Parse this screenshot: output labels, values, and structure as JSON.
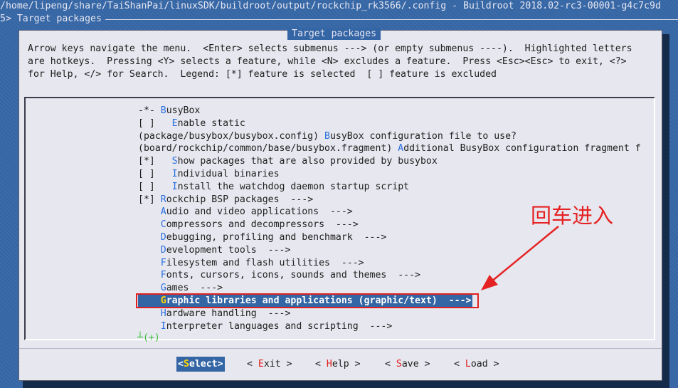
{
  "window": {
    "title": "/home/lipeng/share/TaiShanPai/linuxSDK/buildroot/output/rockchip_rk3566/.config - Buildroot 2018.02-rc3-00001-g4c7c9d",
    "breadcrumb": "5> Target packages"
  },
  "dialog": {
    "title": "Target packages",
    "help_lines": [
      "Arrow keys navigate the menu.  <Enter> selects submenus ---> (or empty submenus ----).  Highlighted letters",
      "are hotkeys.  Pressing <Y> selects a feature, while <N> excludes a feature.  Press <Esc><Esc> to exit, <?>",
      "for Help, </> for Search.  Legend: [*] feature is selected  [ ] feature is excluded"
    ]
  },
  "menu": {
    "items": [
      {
        "pre": "-*- ",
        "hot": "B",
        "rest": "usyBox"
      },
      {
        "pre": "[ ]   ",
        "hot": "E",
        "rest": "nable static"
      },
      {
        "pre": "(package/busybox/busybox.config) ",
        "hot": "B",
        "rest": "usyBox configuration file to use?"
      },
      {
        "pre": "(board/rockchip/common/base/busybox.fragment) ",
        "hot": "A",
        "rest": "dditional BusyBox configuration fragment f"
      },
      {
        "pre": "[*]   ",
        "hot": "S",
        "rest": "how packages that are also provided by busybox"
      },
      {
        "pre": "[ ]   ",
        "hot": "I",
        "rest": "ndividual binaries"
      },
      {
        "pre": "[ ]   ",
        "hot": "I",
        "rest": "nstall the watchdog daemon startup script"
      },
      {
        "pre": "[*] ",
        "hot": "R",
        "rest": "ockchip BSP packages  --->"
      },
      {
        "pre": "    ",
        "hot": "A",
        "rest": "udio and video applications  --->"
      },
      {
        "pre": "    ",
        "hot": "C",
        "rest": "ompressors and decompressors  --->"
      },
      {
        "pre": "    ",
        "hot": "D",
        "rest": "ebugging, profiling and benchmark  --->"
      },
      {
        "pre": "    ",
        "hot": "D",
        "rest": "evelopment tools  --->"
      },
      {
        "pre": "    ",
        "hot": "F",
        "rest": "ilesystem and flash utilities  --->"
      },
      {
        "pre": "    ",
        "hot": "F",
        "rest": "onts, cursors, icons, sounds and themes  --->"
      },
      {
        "pre": "    ",
        "hot": "G",
        "rest": "ames  --->"
      },
      {
        "pre": "    ",
        "hot": "G",
        "rest": "raphic libraries and applications (graphic/text)  --->"
      },
      {
        "pre": "    ",
        "hot": "H",
        "rest": "ardware handling  --->"
      },
      {
        "pre": "    ",
        "hot": "I",
        "rest": "nterpreter languages and scripting  --->"
      }
    ],
    "more_indicator": "┴(+)"
  },
  "buttons": {
    "select": {
      "pre": "<",
      "hot": "S",
      "rest": "elect>"
    },
    "exit": {
      "pre": "< ",
      "hot": "E",
      "rest": "xit >"
    },
    "help": {
      "pre": "< ",
      "hot": "H",
      "rest": "elp >"
    },
    "save": {
      "pre": "< ",
      "hot": "S",
      "rest": "ave >"
    },
    "load": {
      "pre": "< ",
      "hot": "L",
      "rest": "oad >"
    }
  },
  "annotation": {
    "text": "回车进入",
    "color": "#e52222"
  },
  "colors": {
    "background": "#3465a4",
    "dialog": "#e7e7ef",
    "hotkey": "#2a6fe0",
    "selected_hotkey": "#ffd700",
    "button_hotkey": "#e02020"
  }
}
